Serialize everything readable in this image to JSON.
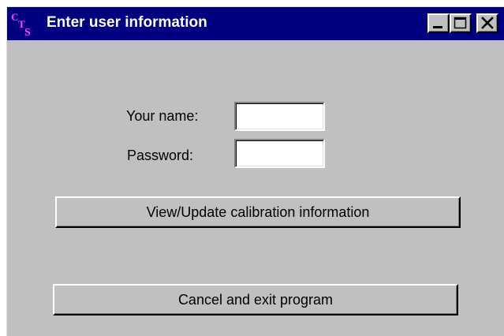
{
  "window": {
    "title": "Enter user information",
    "icon": "cts-app-icon",
    "title_bar_color": "#000080",
    "face_color": "#c0c0c0",
    "controls": {
      "minimize_icon": "minimize-icon",
      "maximize_icon": "maximize-icon",
      "close_icon": "close-icon"
    }
  },
  "form": {
    "name_label": "Your name:",
    "name_value": "",
    "password_label": "Password:",
    "password_value": ""
  },
  "buttons": {
    "calibration_label": "View/Update calibration information",
    "cancel_label": "Cancel and exit program"
  }
}
